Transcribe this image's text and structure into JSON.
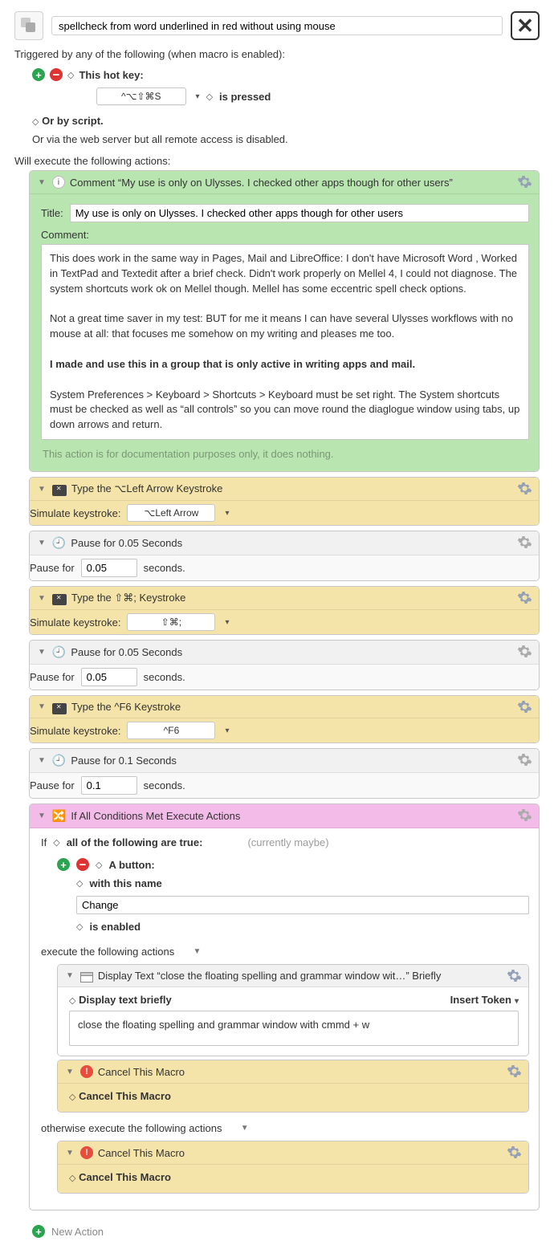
{
  "macro": {
    "name": "spellcheck from word underlined in red without using mouse",
    "triggered_by": "Triggered by any of the following (when macro is enabled):",
    "hot_key_label": "This hot key:",
    "hot_key_combo": "^⌥⇧⌘S",
    "is_pressed": "is pressed",
    "or_by_script": "Or by script.",
    "via_web": "Or via the web server but all remote access is disabled.",
    "will_execute": "Will execute the following actions:"
  },
  "comment_action": {
    "header": "Comment “My use is only on Ulysses. I checked other apps though for other users”",
    "title_label": "Title:",
    "title_value": "My use is only on Ulysses. I checked other apps though for other users",
    "comment_label": "Comment:",
    "p1": "This does work in the same way in Pages, Mail and LibreOffice: I don't have Microsoft Word , Worked in TextPad and Textedit after a brief check. Didn't work properly on Mellel 4, I could not diagnose. The system shortcuts work ok on Mellel though. Mellel has some eccentric spell check options.",
    "p2": "Not a great time saver in my test: BUT for me it means I can have several Ulysses workflows with no mouse at all: that focuses me somehow on my writing and pleases me too.",
    "p3": "I made and use this in a group that is only active in writing apps and mail.",
    "p4": "System Preferences > Keyboard > Shortcuts > Keyboard must be set right. The System shortcuts must be checked as well as “all controls” so you can move round the diaglogue window using tabs, up down arrows and return.",
    "doc_note": "This action is for documentation purposes only, it does nothing."
  },
  "type1": {
    "header": "Type the ⌥Left Arrow Keystroke",
    "sim_label": "Simulate keystroke:",
    "key": "⌥Left Arrow"
  },
  "pause1": {
    "header": "Pause for 0.05 Seconds",
    "label": "Pause for",
    "value": "0.05",
    "unit": "seconds."
  },
  "type2": {
    "header": "Type the ⇧⌘; Keystroke",
    "sim_label": "Simulate keystroke:",
    "key": "⇧⌘;"
  },
  "pause2": {
    "header": "Pause for 0.05 Seconds",
    "label": "Pause for",
    "value": "0.05",
    "unit": "seconds."
  },
  "type3": {
    "header": "Type the ^F6 Keystroke",
    "sim_label": "Simulate keystroke:",
    "key": "^F6"
  },
  "pause3": {
    "header": "Pause for 0.1 Seconds",
    "label": "Pause for",
    "value": "0.1",
    "unit": "seconds."
  },
  "if_action": {
    "header": "If All Conditions Met Execute Actions",
    "if_label": "If",
    "all_true": "all of the following are true:",
    "status": "(currently maybe)",
    "a_button": "A button:",
    "with_name": "with this name",
    "button_name": "Change",
    "is_enabled": "is enabled",
    "execute_label": "execute the following actions",
    "display_header": "Display Text “close the floating spelling and grammar window wit…” Briefly",
    "display_label": "Display text briefly",
    "insert_token": "Insert Token",
    "display_text": "close the floating spelling and grammar window with cmmd + w",
    "cancel1_header": "Cancel This Macro",
    "cancel1_body": "Cancel This Macro",
    "otherwise": "otherwise execute the following actions",
    "cancel2_header": "Cancel This Macro",
    "cancel2_body": "Cancel This Macro"
  },
  "new_action": "New Action"
}
